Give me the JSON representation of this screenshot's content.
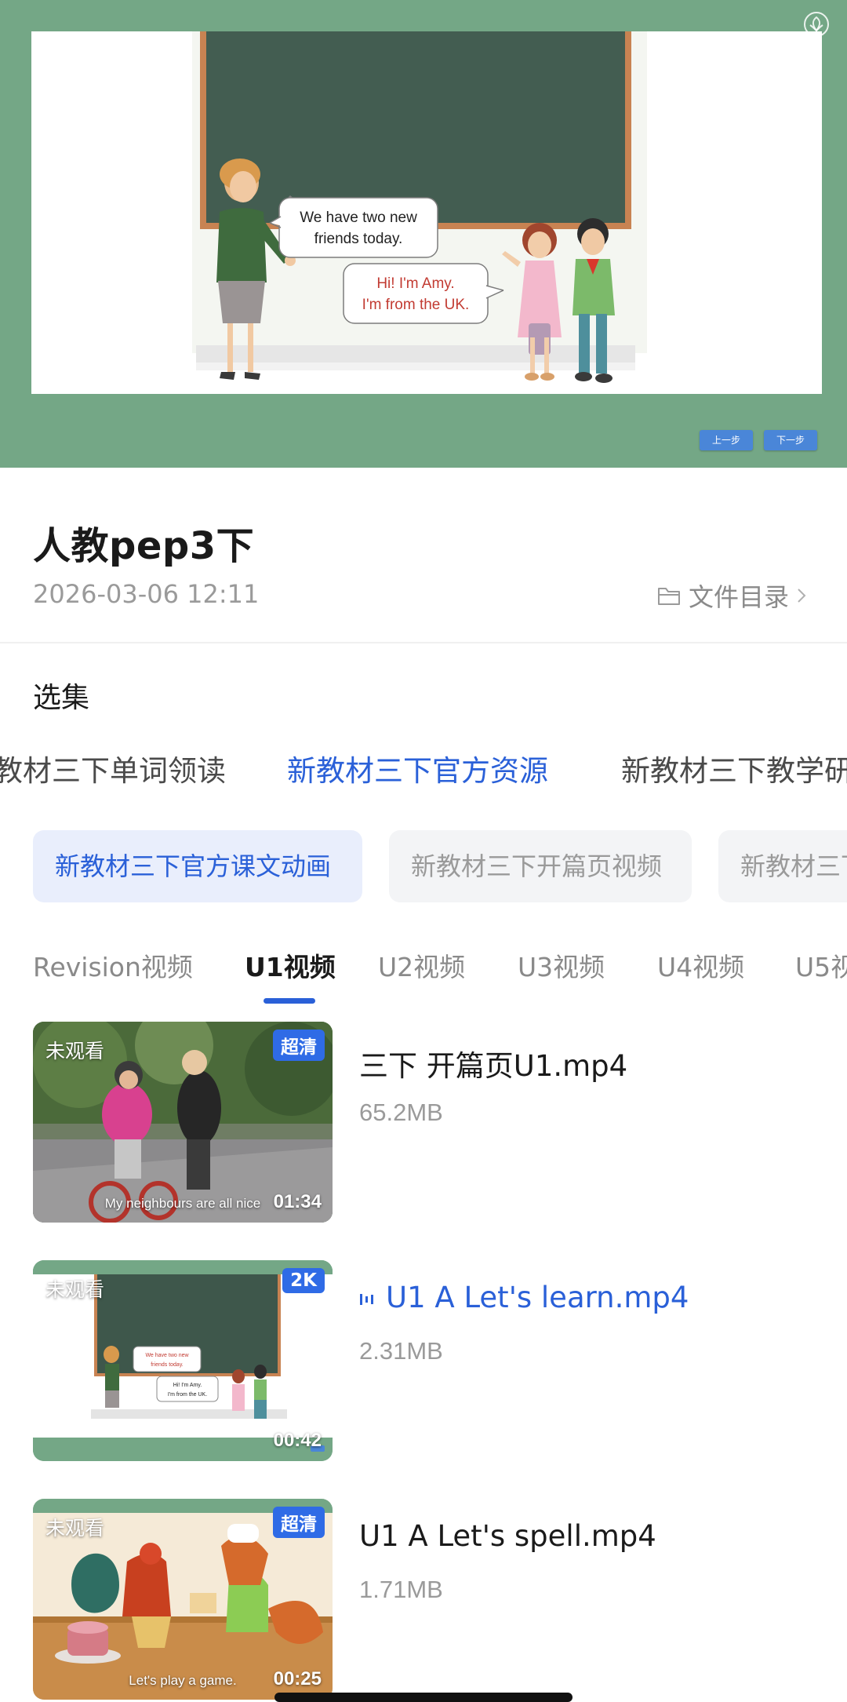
{
  "player": {
    "logo_icon": "hands-logo-icon",
    "bubble_teacher": [
      "We have two new",
      "friends today."
    ],
    "bubble_amy": [
      "Hi! I'm Amy.",
      "I'm from the UK."
    ],
    "prev_label": "上一步",
    "next_label": "下一步",
    "accent": "#74a786"
  },
  "info": {
    "title": "人教pep3下",
    "date": "2026-03-06 12:11",
    "directory_label": "文件目录"
  },
  "section_label": "选集",
  "collections": [
    "教材三下单词领读",
    "新教材三下官方资源",
    "新教材三下教学研"
  ],
  "active_collection": 1,
  "chips": [
    "新教材三下官方课文动画",
    "新教材三下开篇页视频",
    "新教材三下"
  ],
  "unit_tabs": [
    "Revision视频",
    "U1视频",
    "U2视频",
    "U3视频",
    "U4视频",
    "U5视"
  ],
  "active_unit": 1,
  "videos": [
    {
      "title": "三下 开篇页U1.mp4",
      "size": "65.2MB",
      "watch_status": "未观看",
      "quality": "超清",
      "duration": "01:34",
      "caption": "My neighbours are all nice",
      "playing": false
    },
    {
      "title": "U1 A Let's learn.mp4",
      "size": "2.31MB",
      "watch_status": "未观看",
      "quality": "2K",
      "duration": "00:42",
      "playing": true
    },
    {
      "title": "U1 A Let's spell.mp4",
      "size": "1.71MB",
      "watch_status": "未观看",
      "quality": "超清",
      "duration": "00:25",
      "caption": "Let's play a game.",
      "playing": false
    }
  ],
  "colors": {
    "accent_blue": "#2a60d8",
    "badge_blue": "#2f6be6",
    "player_green": "#74a786"
  }
}
